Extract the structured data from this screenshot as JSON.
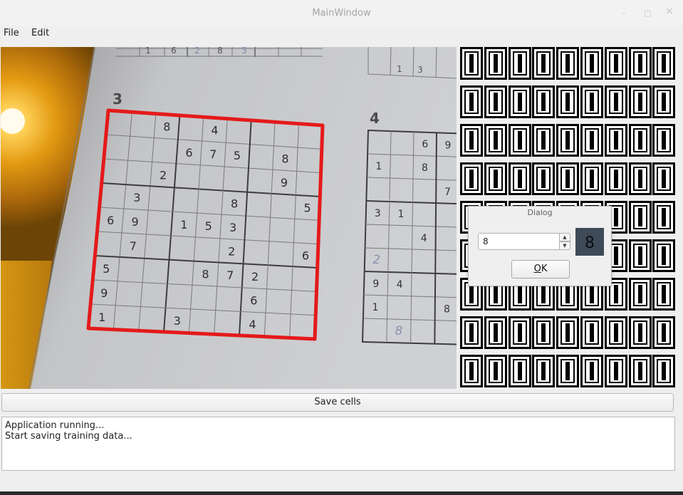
{
  "window": {
    "title": "MainWindow",
    "controls": {
      "minimize": "–",
      "maximize": "□",
      "close": "×"
    }
  },
  "menu": {
    "items": [
      "File",
      "Edit"
    ]
  },
  "camera": {
    "puzzle_numbers": [
      "3",
      "4"
    ],
    "outline_color": "#e41a1a",
    "grid_digits": [
      [
        "",
        "",
        "8",
        "",
        "4",
        "",
        "",
        "",
        ""
      ],
      [
        "",
        "",
        "",
        "6",
        "7",
        "5",
        "",
        "8",
        ""
      ],
      [
        "",
        "",
        "2",
        "",
        "",
        "",
        "",
        "9",
        ""
      ],
      [
        "",
        "3",
        "",
        "",
        "",
        "8",
        "",
        "",
        "5"
      ],
      [
        "6",
        "9",
        "",
        "1",
        "5",
        "3",
        "",
        "",
        ""
      ],
      [
        "",
        "7",
        "",
        "",
        "",
        "2",
        "",
        "",
        "6"
      ],
      [
        "5",
        "",
        "",
        "",
        "8",
        "7",
        "2",
        "",
        ""
      ],
      [
        "9",
        "",
        "",
        "",
        "",
        "",
        "6",
        "",
        ""
      ],
      [
        "1",
        "",
        "",
        "3",
        "",
        "",
        "4",
        "",
        ""
      ]
    ],
    "second_grid_digits": [
      [
        "",
        "",
        "6",
        "9",
        ""
      ],
      [
        "1",
        "",
        "8",
        "",
        ""
      ],
      [
        "",
        "",
        "",
        "7",
        ""
      ],
      [
        "3",
        "1",
        "",
        "",
        ""
      ],
      [
        "",
        "",
        "4",
        "",
        ""
      ],
      [
        "2",
        "",
        "",
        "",
        ""
      ],
      [
        "9",
        "4",
        "",
        "",
        ""
      ],
      [
        "1",
        "",
        "",
        "8",
        ""
      ],
      [
        "",
        "8",
        "",
        "",
        ""
      ]
    ],
    "top_left_partial_digits": [
      "1",
      "6",
      "2",
      "8",
      "3"
    ],
    "top_right_partial_digits": [
      "1",
      "3"
    ]
  },
  "cells_panel": {
    "rows": 9,
    "cols": 9,
    "icon": "zero-glyph-cell-icon"
  },
  "dialog": {
    "title": "Dialog",
    "value": "8",
    "preview_digit": "8",
    "ok_label": "OK",
    "ok_mnemonic": "O",
    "ok_rest": "K"
  },
  "save_button": {
    "label": "Save cells"
  },
  "log": {
    "lines": [
      "Application running...",
      "Start saving training data..."
    ]
  }
}
